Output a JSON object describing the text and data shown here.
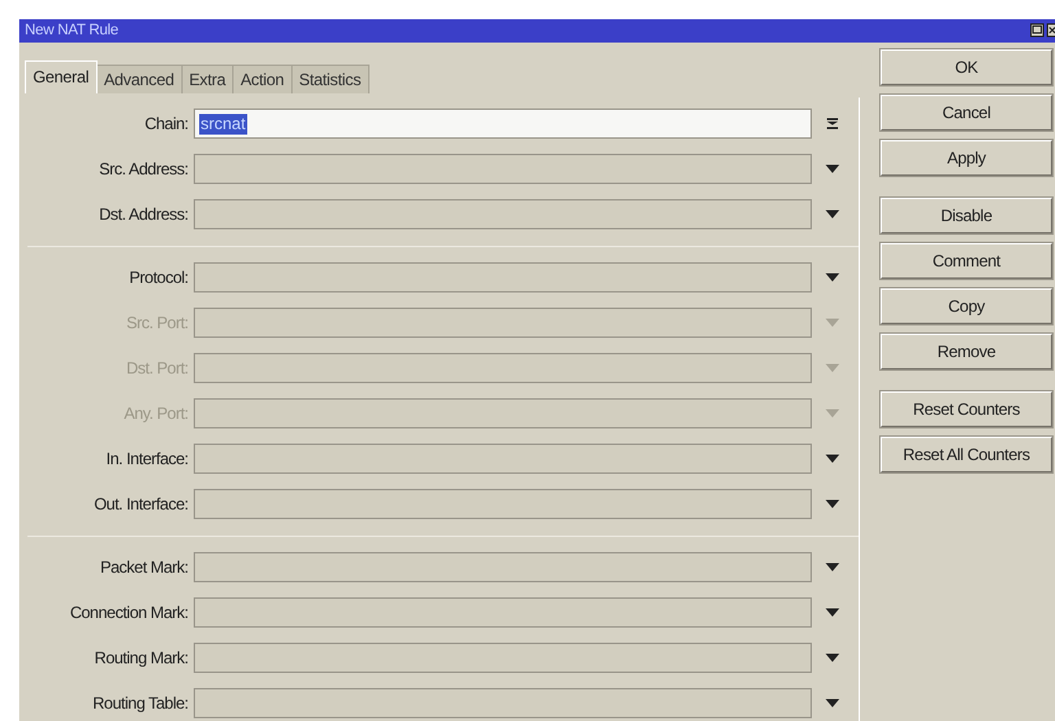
{
  "window": {
    "title": "New NAT Rule"
  },
  "tabs": [
    {
      "label": "General",
      "selected": true
    },
    {
      "label": "Advanced",
      "selected": false
    },
    {
      "label": "Extra",
      "selected": false
    },
    {
      "label": "Action",
      "selected": false
    },
    {
      "label": "Statistics",
      "selected": false
    }
  ],
  "field_groups": [
    [
      {
        "label": "Chain:",
        "kind": "combo",
        "value": "srcnat",
        "value_selected": true,
        "disabled": false
      },
      {
        "label": "Src. Address:",
        "kind": "select",
        "disabled": false
      },
      {
        "label": "Dst. Address:",
        "kind": "select",
        "disabled": false
      }
    ],
    [
      {
        "label": "Protocol:",
        "kind": "select",
        "disabled": false
      },
      {
        "label": "Src. Port:",
        "kind": "select",
        "disabled": true
      },
      {
        "label": "Dst. Port:",
        "kind": "select",
        "disabled": true
      },
      {
        "label": "Any. Port:",
        "kind": "select",
        "disabled": true
      },
      {
        "label": "In. Interface:",
        "kind": "select",
        "disabled": false
      },
      {
        "label": "Out. Interface:",
        "kind": "select",
        "disabled": false
      }
    ],
    [
      {
        "label": "Packet Mark:",
        "kind": "select",
        "disabled": false
      },
      {
        "label": "Connection Mark:",
        "kind": "select",
        "disabled": false
      },
      {
        "label": "Routing Mark:",
        "kind": "select",
        "disabled": false
      },
      {
        "label": "Routing Table:",
        "kind": "select",
        "disabled": false
      }
    ]
  ],
  "button_groups": [
    [
      "OK",
      "Cancel",
      "Apply"
    ],
    [
      "Disable",
      "Comment",
      "Copy",
      "Remove"
    ],
    [
      "Reset Counters",
      "Reset All Counters"
    ]
  ]
}
